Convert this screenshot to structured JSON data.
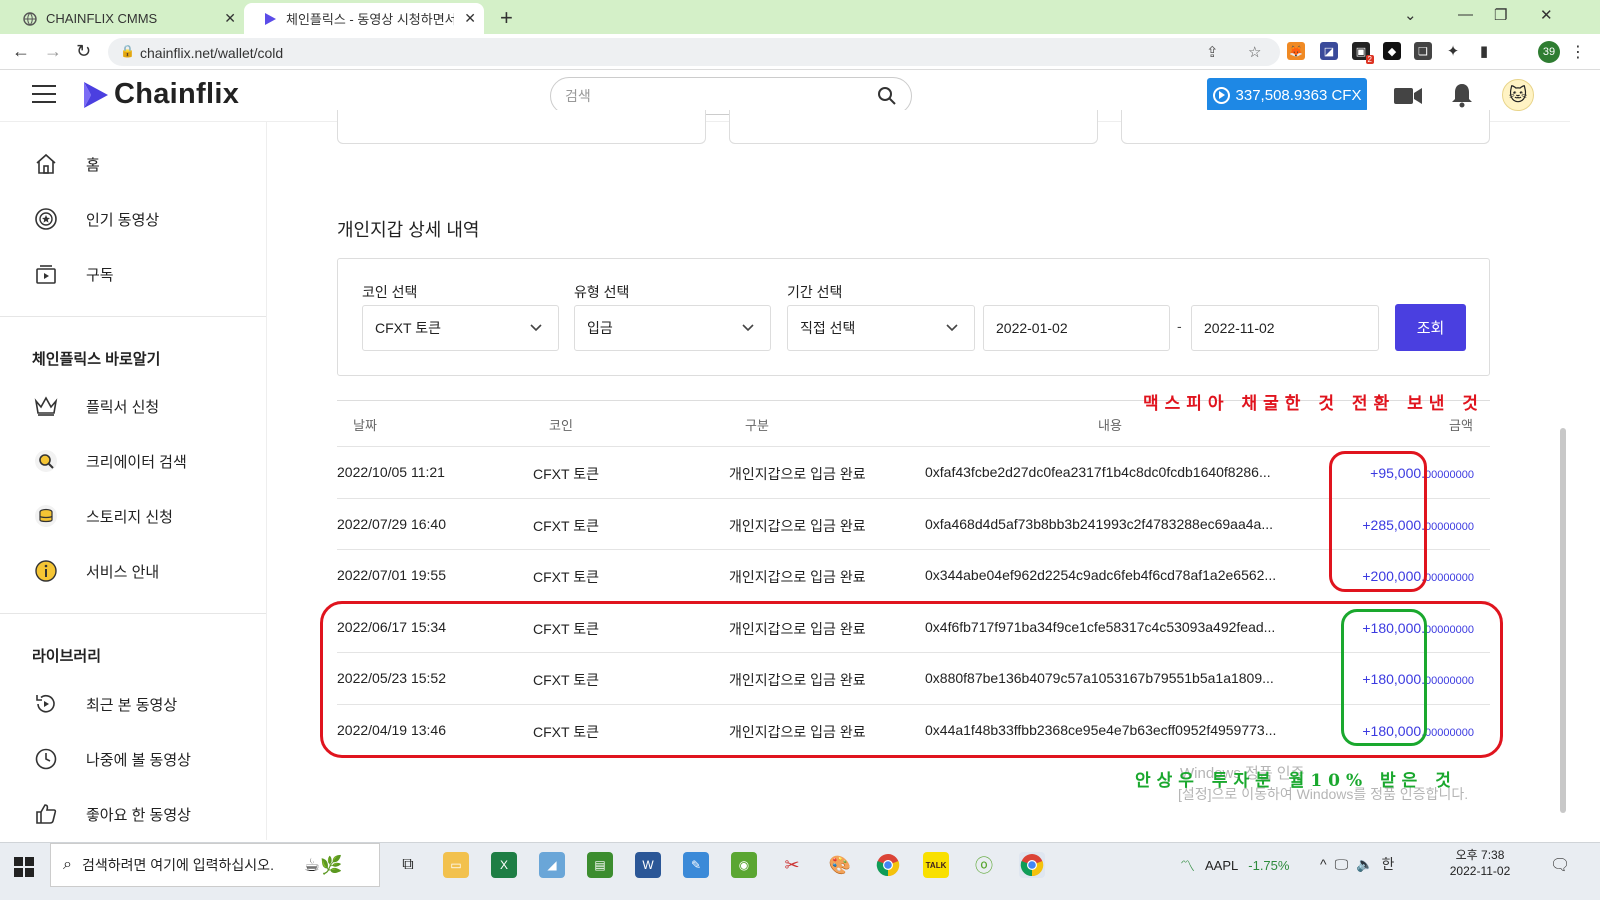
{
  "browser": {
    "tabs": [
      {
        "title": "CHAINFLIX CMMS",
        "active": false
      },
      {
        "title": "체인플릭스 - 동영상 시청하면서",
        "active": true
      }
    ],
    "new_tab": "+",
    "url": "chainflix.net/wallet/cold",
    "profile_badge": "39",
    "extension_badge": "2"
  },
  "header": {
    "logo_text": "Chainflix",
    "search_placeholder": "검색",
    "balance": "337,508.9363 CFX"
  },
  "sidebar": {
    "main_items": [
      {
        "label": "홈",
        "icon": "home-icon"
      },
      {
        "label": "인기 동영상",
        "icon": "popular-icon"
      },
      {
        "label": "구독",
        "icon": "subscription-icon"
      }
    ],
    "section1_title": "체인플릭스 바로알기",
    "section1_items": [
      {
        "label": "플릭서 신청",
        "icon": "crown-icon"
      },
      {
        "label": "크리에이터 검색",
        "icon": "creator-search-icon"
      },
      {
        "label": "스토리지 신청",
        "icon": "storage-icon"
      },
      {
        "label": "서비스 안내",
        "icon": "info-icon"
      }
    ],
    "section2_title": "라이브러리",
    "section2_items": [
      {
        "label": "최근 본 동영상",
        "icon": "history-icon"
      },
      {
        "label": "나중에 볼 동영상",
        "icon": "clock-icon"
      },
      {
        "label": "좋아요 한 동영상",
        "icon": "thumbs-up-icon"
      }
    ]
  },
  "main": {
    "section_title": "개인지갑 상세 내역",
    "filters": {
      "coin_label": "코인 선택",
      "coin_value": "CFXT 토큰",
      "type_label": "유형 선택",
      "type_value": "입금",
      "period_label": "기간 선택",
      "period_value": "직접 선택",
      "date_from": "2022-01-02",
      "date_sep": "-",
      "date_to": "2022-11-02",
      "search_button": "조회"
    },
    "table": {
      "headers": {
        "date": "날짜",
        "coin": "코인",
        "type": "구분",
        "content": "내용",
        "amount": "금액"
      },
      "rows": [
        {
          "date": "2022/10/05 11:21",
          "coin": "CFXT 토큰",
          "type": "개인지갑으로 입금 완료",
          "content": "0xfaf43fcbe2d27dc0fea2317f1b4c8dc0fcdb1640f8286...",
          "amount": "+95,000.",
          "amount_decimals": "00000000"
        },
        {
          "date": "2022/07/29 16:40",
          "coin": "CFXT 토큰",
          "type": "개인지갑으로 입금 완료",
          "content": "0xfa468d4d5af73b8bb3b241993c2f4783288ec69aa4a...",
          "amount": "+285,000.",
          "amount_decimals": "00000000"
        },
        {
          "date": "2022/07/01 19:55",
          "coin": "CFXT 토큰",
          "type": "개인지갑으로 입금 완료",
          "content": "0x344abe04ef962d2254c9adc6feb4f6cd78af1a2e6562...",
          "amount": "+200,000.",
          "amount_decimals": "00000000"
        },
        {
          "date": "2022/06/17 15:34",
          "coin": "CFXT 토큰",
          "type": "개인지갑으로 입금 완료",
          "content": "0x4f6fb717f971ba34f9ce1cfe58317c4c53093a492fead...",
          "amount": "+180,000.",
          "amount_decimals": "00000000"
        },
        {
          "date": "2022/05/23 15:52",
          "coin": "CFXT 토큰",
          "type": "개인지갑으로 입금 완료",
          "content": "0x880f87be136b4079c57a1053167b79551b5a1a1809...",
          "amount": "+180,000.",
          "amount_decimals": "00000000"
        },
        {
          "date": "2022/04/19 13:46",
          "coin": "CFXT 토큰",
          "type": "개인지갑으로 입금 완료",
          "content": "0x44a1f48b33ffbb2368ce95e4e7b63ecff0952f4959773...",
          "amount": "+180,000.",
          "amount_decimals": "00000000"
        }
      ]
    }
  },
  "annotations": {
    "top_note": "맥스피아 채굴한 것 전환 보낸 것",
    "bottom_note": "안상우 투자분 월10% 받은 것",
    "top_color": "#e0141e",
    "bottom_color": "#1aa82e"
  },
  "watermark": {
    "line1": "Windows 정품 인증",
    "line2": "[설정]으로 이동하여 Windows를 정품 인증합니다."
  },
  "taskbar": {
    "search_placeholder": "검색하려면 여기에 입력하십시오.",
    "stock_symbol": "AAPL",
    "stock_change": "-1.75%",
    "ime": "한",
    "time": "오후 7:38",
    "date": "2022-11-02"
  },
  "colors": {
    "accent_blue": "#1e88e5",
    "primary_button": "#4a3fe0",
    "amount_text": "#3b3ae0",
    "tab_strip": "#d4f0c8"
  }
}
